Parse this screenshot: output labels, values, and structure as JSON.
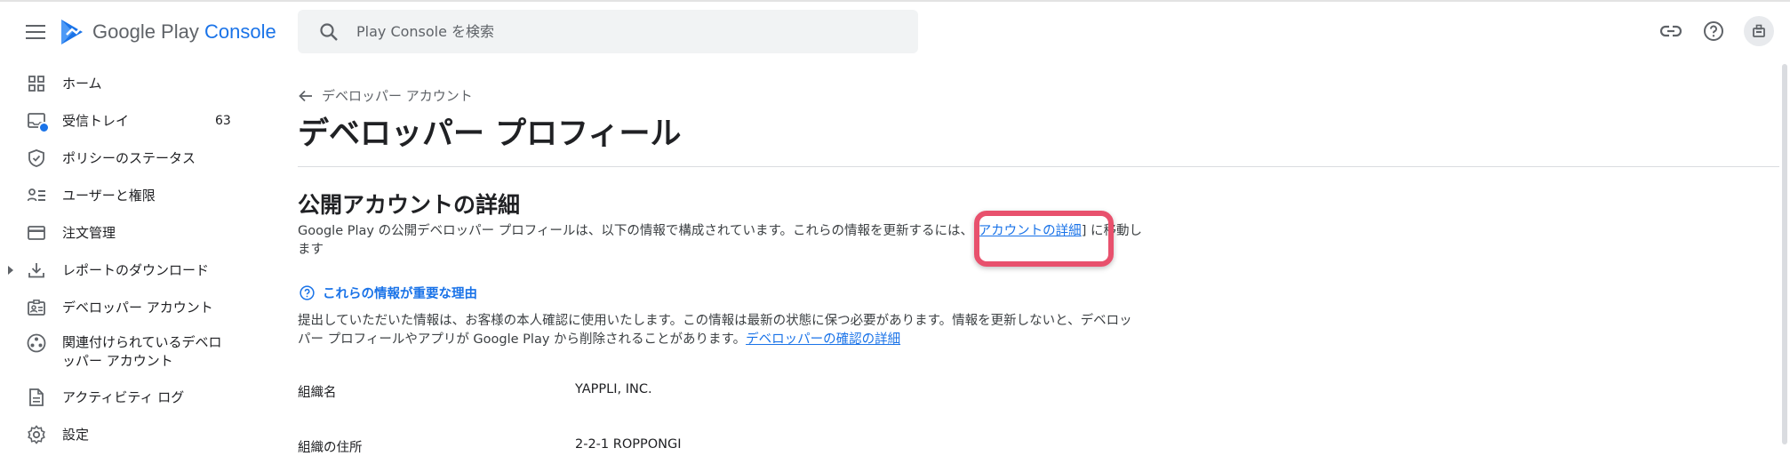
{
  "app": {
    "logo_google_play": "Google Play",
    "logo_console": "Console"
  },
  "search": {
    "placeholder": "Play Console を検索"
  },
  "header_icons": [
    "link-icon",
    "help-icon",
    "account-icon"
  ],
  "sidebar": {
    "items": [
      {
        "label": "ホーム",
        "icon": "dashboard-grid-icon"
      },
      {
        "label": "受信トレイ",
        "icon": "inbox-icon",
        "count": "63"
      },
      {
        "label": "ポリシーのステータス",
        "icon": "shield-check-icon"
      },
      {
        "label": "ユーザーと権限",
        "icon": "users-icon"
      },
      {
        "label": "注文管理",
        "icon": "credit-card-icon"
      },
      {
        "label": "レポートのダウンロード",
        "icon": "download-icon"
      },
      {
        "label": "デベロッパー アカウント",
        "icon": "badge-icon"
      },
      {
        "label": "関連付けられているデベロッパー アカウント",
        "icon": "linked-accounts-icon"
      },
      {
        "label": "アクティビティ ログ",
        "icon": "document-icon"
      },
      {
        "label": "設定",
        "icon": "gear-icon"
      }
    ]
  },
  "main": {
    "back_label": "デベロッパー アカウント",
    "page_title": "デベロッパー プロフィール",
    "section_title": "公開アカウントの詳細",
    "intro_before": "Google Play の公開デベロッパー プロフィールは、以下の情報で構成されています。これらの情報を更新するには、[",
    "intro_link": "アカウントの詳細",
    "intro_after": "] に移動します",
    "why_label": "これらの情報が重要な理由",
    "notice_text": "提出していただいた情報は、お客様の本人確認に使用いたします。この情報は最新の状態に保つ必要があります。情報を更新しないと、デベロッパー プロフィールやアプリが Google Play から削除されることがあります。",
    "notice_link": "デベロッパーの確認の詳細",
    "fields": [
      {
        "label": "組織名",
        "value": "YAPPLI, INC."
      },
      {
        "label": "組織の住所",
        "value": "2-2-1 ROPPONGI"
      }
    ]
  },
  "colors": {
    "accent": "#1a73e8",
    "highlight": "#e8516d"
  }
}
